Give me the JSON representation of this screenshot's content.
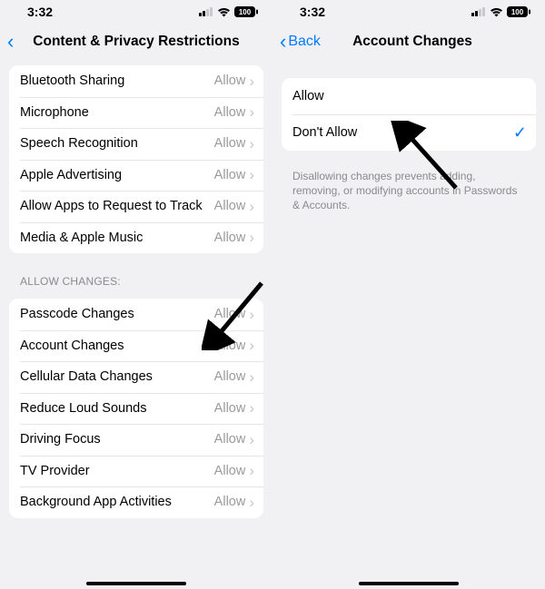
{
  "status": {
    "time": "3:32",
    "battery": "100"
  },
  "left": {
    "nav_title": "Content & Privacy Restrictions",
    "group1": {
      "rows": [
        {
          "label": "Bluetooth Sharing",
          "value": "Allow"
        },
        {
          "label": "Microphone",
          "value": "Allow"
        },
        {
          "label": "Speech Recognition",
          "value": "Allow"
        },
        {
          "label": "Apple Advertising",
          "value": "Allow"
        },
        {
          "label": "Allow Apps to Request to Track",
          "value": "Allow"
        },
        {
          "label": "Media & Apple Music",
          "value": "Allow"
        }
      ]
    },
    "group2_header": "ALLOW CHANGES:",
    "group2": {
      "rows": [
        {
          "label": "Passcode Changes",
          "value": "Allow"
        },
        {
          "label": "Account Changes",
          "value": "Allow"
        },
        {
          "label": "Cellular Data Changes",
          "value": "Allow"
        },
        {
          "label": "Reduce Loud Sounds",
          "value": "Allow"
        },
        {
          "label": "Driving Focus",
          "value": "Allow"
        },
        {
          "label": "TV Provider",
          "value": "Allow"
        },
        {
          "label": "Background App Activities",
          "value": "Allow"
        }
      ]
    }
  },
  "right": {
    "back_label": "Back",
    "nav_title": "Account Changes",
    "options": {
      "rows": [
        {
          "label": "Allow",
          "selected": false
        },
        {
          "label": "Don't Allow",
          "selected": true
        }
      ]
    },
    "footnote": "Disallowing changes prevents adding, removing, or modifying accounts in Passwords & Accounts."
  }
}
